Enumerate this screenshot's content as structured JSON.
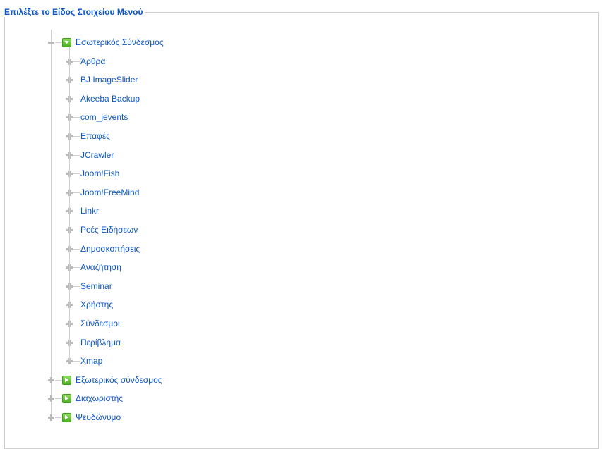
{
  "legend": "Επιλέξτε το Είδος Στοιχείου Μενού",
  "tree": {
    "root_groups": [
      {
        "label": "Εσωτερικός Σύνδεσμος",
        "expanded": true,
        "icon": "folder-open-icon",
        "children": [
          "Άρθρα",
          "BJ ImageSlider",
          "Akeeba Backup",
          "com_jevents",
          "Επαφές",
          "JCrawler",
          "Joom!Fish",
          "Joom!FreeMind",
          "Linkr",
          "Ροές Ειδήσεων",
          "Δημοσκοπήσεις",
          "Αναζήτηση",
          "Seminar",
          "Χρήστης",
          "Σύνδεσμοι",
          "Περίβλημα",
          "Xmap"
        ]
      },
      {
        "label": "Εξωτερικός σύνδεσμος",
        "expanded": false,
        "icon": "folder-closed-icon",
        "children": []
      },
      {
        "label": "Διαχωριστής",
        "expanded": false,
        "icon": "folder-closed-icon",
        "children": []
      },
      {
        "label": "Ψευδώνυμο",
        "expanded": false,
        "icon": "folder-closed-icon",
        "children": []
      }
    ]
  },
  "colors": {
    "link": "#0b55c4",
    "tree_lines": "#cfcfcf",
    "expander": "#b9b9b9",
    "folder_green": "#4fae22"
  }
}
